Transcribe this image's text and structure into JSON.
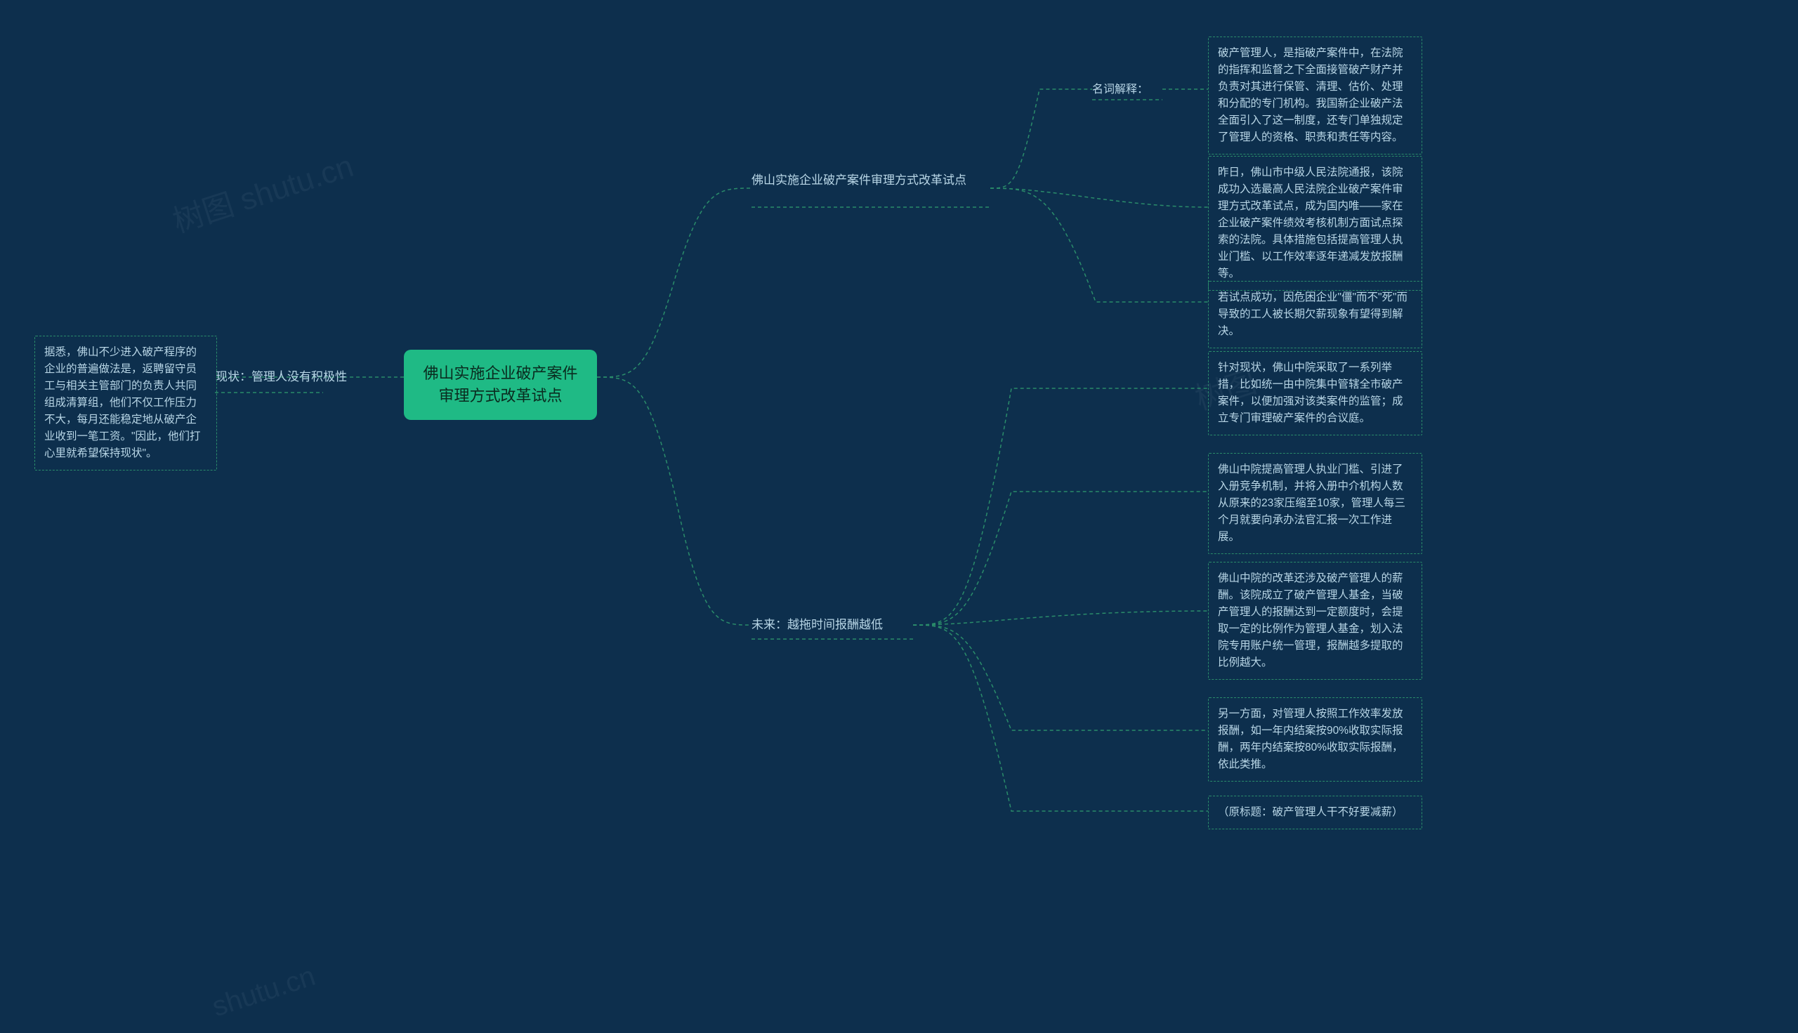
{
  "root": {
    "title": "佛山实施企业破产案件审理方式改革试点"
  },
  "left": {
    "branch_label": "现状：管理人没有积极性",
    "leaf": "据悉，佛山不少进入破产程序的企业的普遍做法是，返聘留守员工与相关主管部门的负责人共同组成清算组，他们不仅工作压力不大，每月还能稳定地从破产企业收到一笔工资。\"因此，他们打心里就希望保持现状\"。"
  },
  "right_branch1": {
    "label": "佛山实施企业破产案件审理方式改革试点",
    "sub_label": "名词解释：",
    "leaf1": "破产管理人，是指破产案件中，在法院的指挥和监督之下全面接管破产财产并负责对其进行保管、清理、估价、处理和分配的专门机构。我国新企业破产法全面引入了这一制度，还专门单独规定了管理人的资格、职责和责任等内容。",
    "leaf2": "昨日，佛山市中级人民法院通报，该院成功入选最高人民法院企业破产案件审理方式改革试点，成为国内唯——家在企业破产案件绩效考核机制方面试点探索的法院。具体措施包括提高管理人执业门槛、以工作效率逐年递减发放报酬等。",
    "leaf3": "若试点成功，因危困企业\"僵\"而不\"死\"而导致的工人被长期欠薪现象有望得到解决。"
  },
  "right_branch2": {
    "label": "未来：越拖时间报酬越低",
    "leaf1": "针对现状，佛山中院采取了一系列举措，比如统一由中院集中管辖全市破产案件，以便加强对该类案件的监管；成立专门审理破产案件的合议庭。",
    "leaf2": "佛山中院提高管理人执业门槛、引进了入册竞争机制，并将入册中介机构人数从原来的23家压缩至10家，管理人每三个月就要向承办法官汇报一次工作进展。",
    "leaf3": "佛山中院的改革还涉及破产管理人的薪酬。该院成立了破产管理人基金，当破产管理人的报酬达到一定额度时，会提取一定的比例作为管理人基金，划入法院专用账户统一管理，报酬越多提取的比例越大。",
    "leaf4": "另一方面，对管理人按照工作效率发放报酬，如一年内结案按90%收取实际报酬，两年内结案按80%收取实际报酬，依此类推。",
    "leaf5": "（原标题：破产管理人干不好要减薪）"
  },
  "watermarks": {
    "w1": "树图 shutu.cn",
    "w2": "树图",
    "w3": "shutu.cn"
  },
  "colors": {
    "bg": "#0d2f4d",
    "accent": "#1fba85",
    "stroke": "#2a8c6a",
    "text": "#b8d6e6"
  }
}
